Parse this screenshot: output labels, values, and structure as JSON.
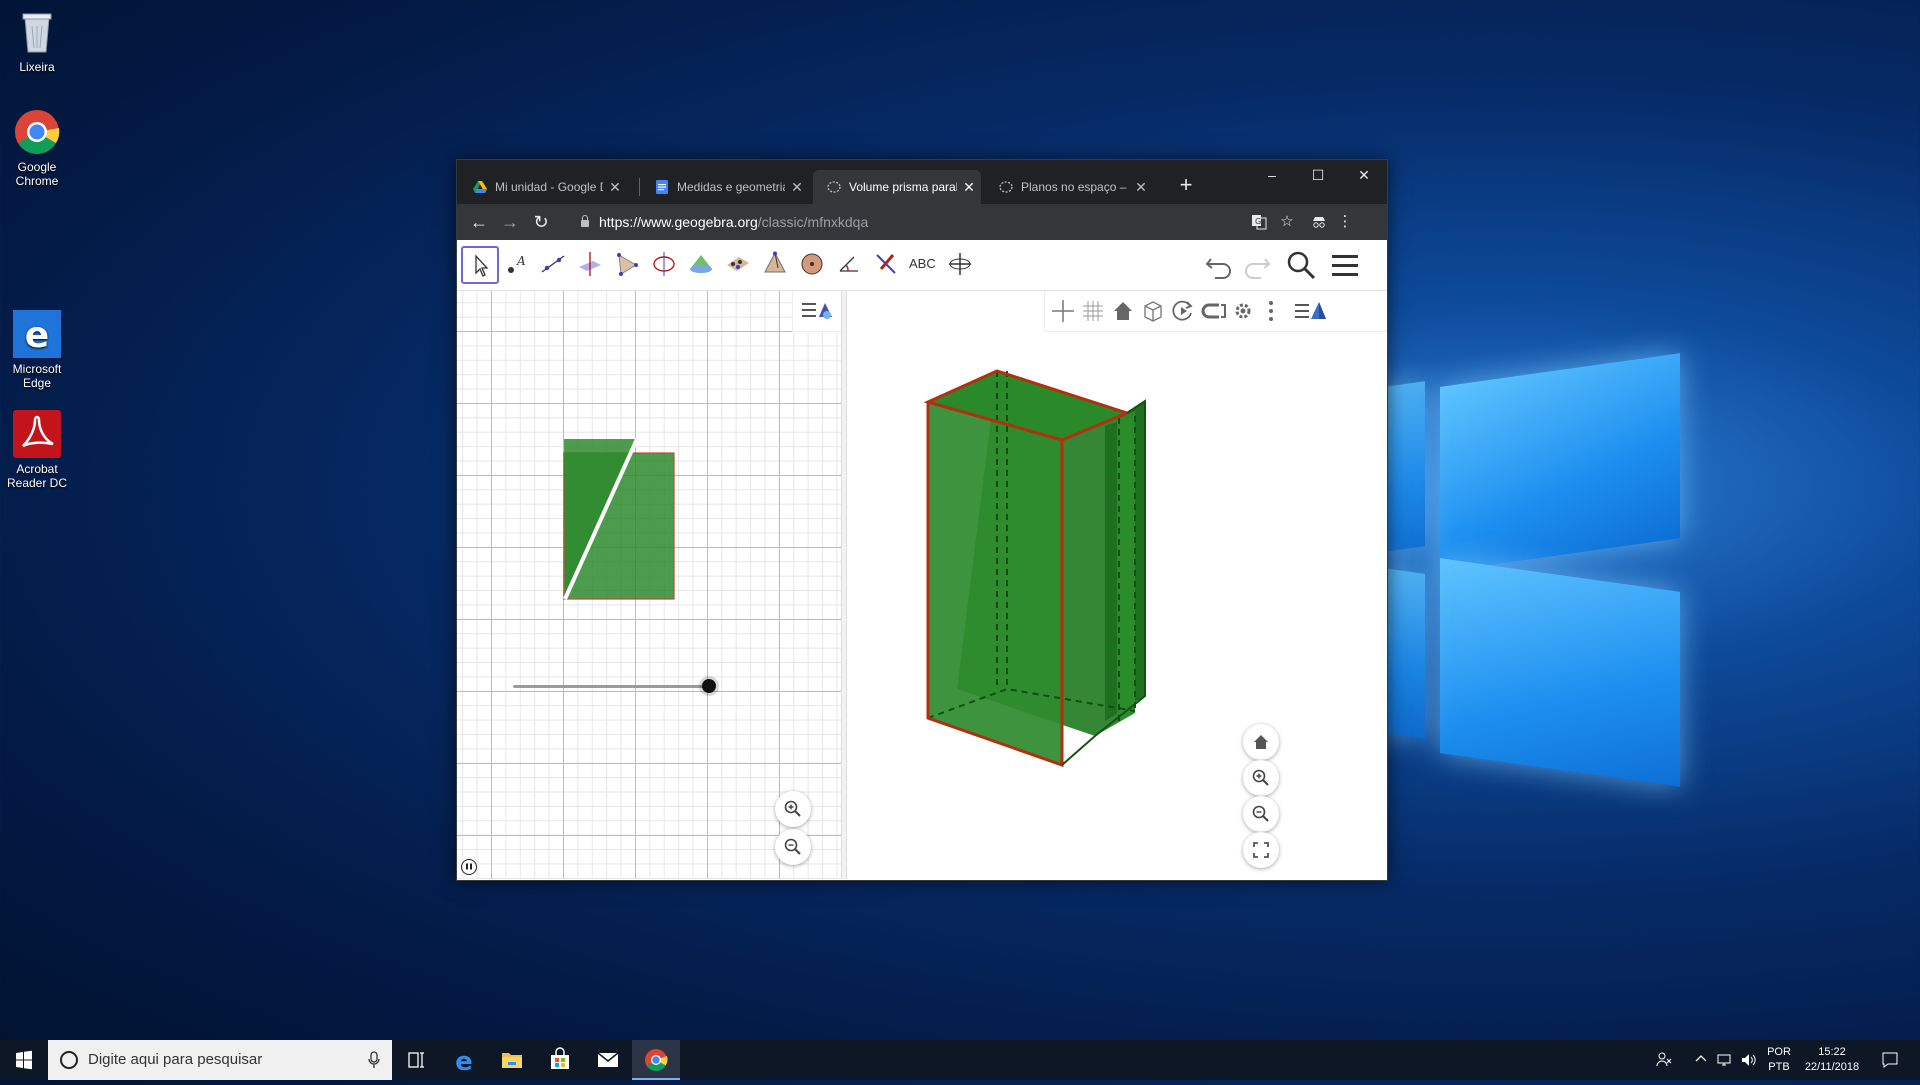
{
  "desktop": {
    "icons": [
      {
        "label": "Lixeira"
      },
      {
        "label": "Google\nChrome"
      },
      {
        "label": "Microsoft\nEdge"
      },
      {
        "label": "Acrobat\nReader DC"
      }
    ]
  },
  "browser": {
    "tabs": [
      {
        "title": "Mi unidad - Google D",
        "icon": "google-drive-icon"
      },
      {
        "title": "Medidas e geometria",
        "icon": "google-docs-icon"
      },
      {
        "title": "Volume prisma paralel",
        "icon": "geogebra-icon",
        "active": true
      },
      {
        "title": "Planos no espaço – G",
        "icon": "geogebra-icon"
      }
    ],
    "new_tab_label": "+",
    "window_controls": {
      "minimize": "–",
      "maximize": "☐",
      "close": "✕"
    },
    "url": {
      "host": "https://www.geogebra.org",
      "path": "/classic/mfnxkdqa"
    }
  },
  "geogebra": {
    "tools": [
      "move-tool",
      "point-tool",
      "line-tool",
      "perpendicular-line-tool",
      "polygon-tool",
      "circle-axis-tool",
      "intersect-surfaces-tool",
      "plane-tool",
      "pyramid-tool",
      "sphere-tool",
      "angle-tool",
      "reflect-tool",
      "text-tool",
      "rotate-view-tool"
    ],
    "text_tool_label": "ABC",
    "slider_value": 1.0,
    "colors": {
      "solid_fill": "#2e8b2e",
      "edge": "#b03010",
      "selected_tool_border": "#6b6bd6"
    }
  },
  "taskbar": {
    "search_placeholder": "Digite aqui para pesquisar",
    "lang_top": "POR",
    "lang_bottom": "PTB",
    "time": "15:22",
    "date": "22/11/2018"
  }
}
